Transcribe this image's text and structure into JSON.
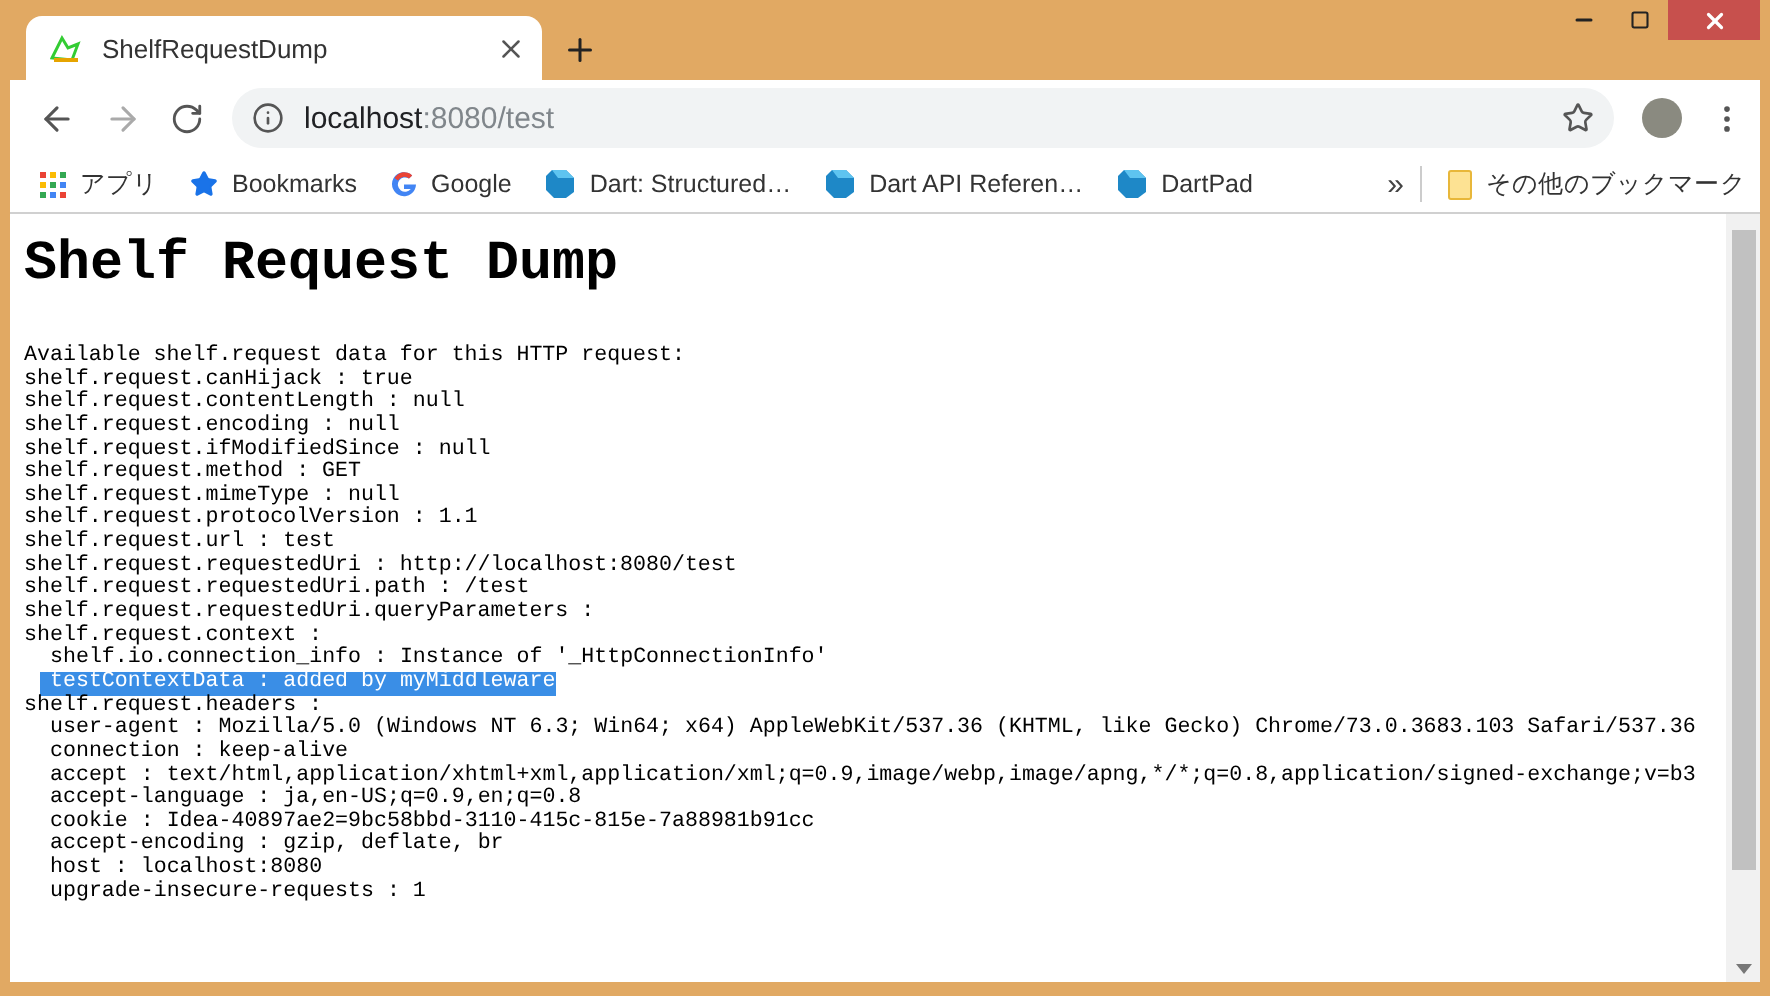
{
  "tab": {
    "title": "ShelfRequestDump",
    "selected": true
  },
  "address": {
    "host": "localhost",
    "rest": ":8080/test"
  },
  "bookmarks": [
    {
      "kind": "apps",
      "label": "アプリ"
    },
    {
      "kind": "star",
      "label": "Bookmarks"
    },
    {
      "kind": "google",
      "label": "Google"
    },
    {
      "kind": "dart",
      "label": "Dart: Structured…"
    },
    {
      "kind": "dart",
      "label": "Dart API Referen…"
    },
    {
      "kind": "dart",
      "label": "DartPad"
    }
  ],
  "overflow": "»",
  "other_bookmarks": "その他のブックマーク",
  "page": {
    "heading": "Shelf Request Dump",
    "lines": [
      {
        "text": "Available shelf.request data for this HTTP request:"
      },
      {
        "text": "shelf.request.canHijack : true"
      },
      {
        "text": "shelf.request.contentLength : null"
      },
      {
        "text": "shelf.request.encoding : null"
      },
      {
        "text": "shelf.request.ifModifiedSince : null"
      },
      {
        "text": "shelf.request.method : GET"
      },
      {
        "text": "shelf.request.mimeType : null"
      },
      {
        "text": "shelf.request.protocolVersion : 1.1"
      },
      {
        "text": "shelf.request.url : test"
      },
      {
        "text": "shelf.request.requestedUri : http://localhost:8080/test"
      },
      {
        "text": "shelf.request.requestedUri.path : /test"
      },
      {
        "text": "shelf.request.requestedUri.queryParameters :"
      },
      {
        "text": "shelf.request.context :",
        "children": [
          {
            "text": "shelf.io.connection_info : Instance of '_HttpConnectionInfo'",
            "highlighted": false
          },
          {
            "text": "testContextData : added by myMiddleware",
            "highlighted": true
          }
        ]
      },
      {
        "text": "shelf.request.headers :",
        "children": [
          {
            "text": "user-agent : Mozilla/5.0 (Windows NT 6.3; Win64; x64) AppleWebKit/537.36 (KHTML, like Gecko) Chrome/73.0.3683.103 Safari/537.36"
          },
          {
            "text": "connection : keep-alive"
          },
          {
            "text": "accept : text/html,application/xhtml+xml,application/xml;q=0.9,image/webp,image/apng,*/*;q=0.8,application/signed-exchange;v=b3"
          },
          {
            "text": "accept-language : ja,en-US;q=0.9,en;q=0.8"
          },
          {
            "text": "cookie : Idea-40897ae2=9bc58bbd-3110-415c-815e-7a88981b91cc"
          },
          {
            "text": "accept-encoding : gzip, deflate, br"
          },
          {
            "text": "host : localhost:8080"
          },
          {
            "text": "upgrade-insecure-requests : 1"
          }
        ]
      }
    ]
  }
}
